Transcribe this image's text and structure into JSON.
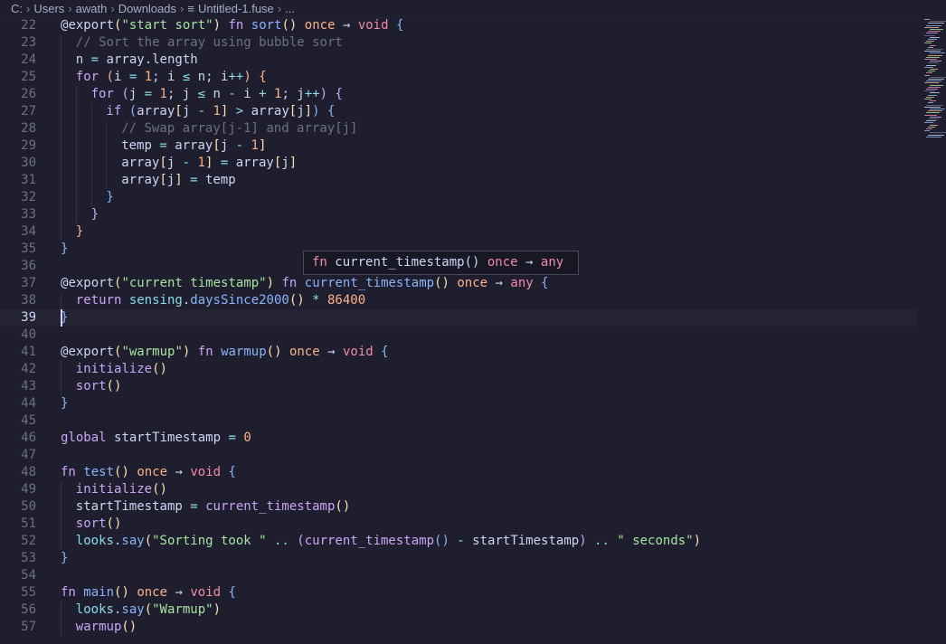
{
  "breadcrumb": {
    "items": [
      "C:",
      "Users",
      "awath",
      "Downloads"
    ],
    "file": "Untitled-1.fuse",
    "ellipsis": "..."
  },
  "colors": {
    "background": "#1e1e2e",
    "keyword": "#cba6f7",
    "function": "#89b4fa",
    "string": "#a6e3a1",
    "number": "#fab387",
    "comment": "#6c7086",
    "type": "#f38ba8",
    "text": "#cdd6f4"
  },
  "hover": {
    "signature": "fn current_timestamp() once → any"
  },
  "editor": {
    "active_line": 39,
    "lines": [
      {
        "n": 22,
        "indent": 0,
        "tokens": [
          [
            "@",
            "#cdd6f4"
          ],
          [
            "export",
            "#cdd6f4"
          ],
          [
            "(",
            "#f9e2af"
          ],
          [
            "\"start sort\"",
            "#a6e3a1"
          ],
          [
            ")",
            "#f9e2af"
          ],
          [
            " ",
            ""
          ],
          [
            "fn",
            "#cba6f7"
          ],
          [
            " ",
            ""
          ],
          [
            "sort",
            "#89b4fa"
          ],
          [
            "()",
            "#f9e2af"
          ],
          [
            " ",
            ""
          ],
          [
            "once",
            "#fab387"
          ],
          [
            " ",
            ""
          ],
          [
            "→",
            "#cdd6f4"
          ],
          [
            " ",
            ""
          ],
          [
            "void",
            "#f38ba8"
          ],
          [
            " ",
            ""
          ],
          [
            "{",
            "#89b4fa"
          ]
        ]
      },
      {
        "n": 23,
        "indent": 2,
        "tokens": [
          [
            "// Sort the array using bubble sort",
            "#6c7086"
          ]
        ]
      },
      {
        "n": 24,
        "indent": 2,
        "tokens": [
          [
            "n",
            "#cdd6f4"
          ],
          [
            " = ",
            "#89dceb"
          ],
          [
            "array",
            "#cdd6f4"
          ],
          [
            ".",
            "#cdd6f4"
          ],
          [
            "length",
            "#cdd6f4"
          ]
        ]
      },
      {
        "n": 25,
        "indent": 2,
        "tokens": [
          [
            "for",
            "#cba6f7"
          ],
          [
            " ",
            ""
          ],
          [
            "(",
            "#fab387"
          ],
          [
            "i",
            "#cdd6f4"
          ],
          [
            " = ",
            "#89dceb"
          ],
          [
            "1",
            "#fab387"
          ],
          [
            "; ",
            "#cdd6f4"
          ],
          [
            "i",
            "#cdd6f4"
          ],
          [
            " ≤ ",
            "#89dceb"
          ],
          [
            "n",
            "#cdd6f4"
          ],
          [
            "; ",
            "#cdd6f4"
          ],
          [
            "i",
            "#cdd6f4"
          ],
          [
            "++",
            "#89dceb"
          ],
          [
            ")",
            "#fab387"
          ],
          [
            " ",
            ""
          ],
          [
            "{",
            "#fab387"
          ]
        ]
      },
      {
        "n": 26,
        "indent": 4,
        "tokens": [
          [
            "for",
            "#cba6f7"
          ],
          [
            " ",
            ""
          ],
          [
            "(",
            "#cba6f7"
          ],
          [
            "j",
            "#cdd6f4"
          ],
          [
            " = ",
            "#89dceb"
          ],
          [
            "1",
            "#fab387"
          ],
          [
            "; ",
            "#cdd6f4"
          ],
          [
            "j",
            "#cdd6f4"
          ],
          [
            " ≤ ",
            "#89dceb"
          ],
          [
            "n",
            "#cdd6f4"
          ],
          [
            " - ",
            "#89dceb"
          ],
          [
            "i",
            "#cdd6f4"
          ],
          [
            " + ",
            "#89dceb"
          ],
          [
            "1",
            "#fab387"
          ],
          [
            "; ",
            "#cdd6f4"
          ],
          [
            "j",
            "#cdd6f4"
          ],
          [
            "++",
            "#89dceb"
          ],
          [
            ")",
            "#cba6f7"
          ],
          [
            " ",
            ""
          ],
          [
            "{",
            "#cba6f7"
          ]
        ]
      },
      {
        "n": 27,
        "indent": 6,
        "tokens": [
          [
            "if",
            "#cba6f7"
          ],
          [
            " ",
            ""
          ],
          [
            "(",
            "#89b4fa"
          ],
          [
            "array",
            "#cdd6f4"
          ],
          [
            "[",
            "#f9e2af"
          ],
          [
            "j",
            "#cdd6f4"
          ],
          [
            " - ",
            "#89dceb"
          ],
          [
            "1",
            "#fab387"
          ],
          [
            "]",
            "#f9e2af"
          ],
          [
            " > ",
            "#89dceb"
          ],
          [
            "array",
            "#cdd6f4"
          ],
          [
            "[",
            "#f9e2af"
          ],
          [
            "j",
            "#cdd6f4"
          ],
          [
            "]",
            "#f9e2af"
          ],
          [
            ")",
            "#89b4fa"
          ],
          [
            " ",
            ""
          ],
          [
            "{",
            "#89b4fa"
          ]
        ]
      },
      {
        "n": 28,
        "indent": 8,
        "tokens": [
          [
            "// Swap array[j-1] and array[j]",
            "#6c7086"
          ]
        ]
      },
      {
        "n": 29,
        "indent": 8,
        "tokens": [
          [
            "temp",
            "#cdd6f4"
          ],
          [
            " = ",
            "#89dceb"
          ],
          [
            "array",
            "#cdd6f4"
          ],
          [
            "[",
            "#f9e2af"
          ],
          [
            "j",
            "#cdd6f4"
          ],
          [
            " - ",
            "#89dceb"
          ],
          [
            "1",
            "#fab387"
          ],
          [
            "]",
            "#f9e2af"
          ]
        ]
      },
      {
        "n": 30,
        "indent": 8,
        "tokens": [
          [
            "array",
            "#cdd6f4"
          ],
          [
            "[",
            "#f9e2af"
          ],
          [
            "j",
            "#cdd6f4"
          ],
          [
            " - ",
            "#89dceb"
          ],
          [
            "1",
            "#fab387"
          ],
          [
            "]",
            "#f9e2af"
          ],
          [
            " = ",
            "#89dceb"
          ],
          [
            "array",
            "#cdd6f4"
          ],
          [
            "[",
            "#f9e2af"
          ],
          [
            "j",
            "#cdd6f4"
          ],
          [
            "]",
            "#f9e2af"
          ]
        ]
      },
      {
        "n": 31,
        "indent": 8,
        "tokens": [
          [
            "array",
            "#cdd6f4"
          ],
          [
            "[",
            "#f9e2af"
          ],
          [
            "j",
            "#cdd6f4"
          ],
          [
            "]",
            "#f9e2af"
          ],
          [
            " = ",
            "#89dceb"
          ],
          [
            "temp",
            "#cdd6f4"
          ]
        ]
      },
      {
        "n": 32,
        "indent": 6,
        "tokens": [
          [
            "}",
            "#89b4fa"
          ]
        ]
      },
      {
        "n": 33,
        "indent": 4,
        "tokens": [
          [
            "}",
            "#cba6f7"
          ]
        ]
      },
      {
        "n": 34,
        "indent": 2,
        "tokens": [
          [
            "}",
            "#fab387"
          ]
        ]
      },
      {
        "n": 35,
        "indent": 0,
        "tokens": [
          [
            "}",
            "#89b4fa"
          ]
        ]
      },
      {
        "n": 36,
        "indent": 0,
        "tokens": []
      },
      {
        "n": 37,
        "indent": 0,
        "tokens": [
          [
            "@",
            "#cdd6f4"
          ],
          [
            "export",
            "#cdd6f4"
          ],
          [
            "(",
            "#f9e2af"
          ],
          [
            "\"current timestamp\"",
            "#a6e3a1"
          ],
          [
            ")",
            "#f9e2af"
          ],
          [
            " ",
            ""
          ],
          [
            "fn",
            "#cba6f7"
          ],
          [
            " ",
            ""
          ],
          [
            "current_timestamp",
            "#89b4fa"
          ],
          [
            "()",
            "#f9e2af"
          ],
          [
            " ",
            ""
          ],
          [
            "once",
            "#fab387"
          ],
          [
            " ",
            ""
          ],
          [
            "→",
            "#cdd6f4"
          ],
          [
            " ",
            ""
          ],
          [
            "any",
            "#f38ba8"
          ],
          [
            " ",
            ""
          ],
          [
            "{",
            "#89b4fa"
          ]
        ]
      },
      {
        "n": 38,
        "indent": 2,
        "tokens": [
          [
            "return",
            "#cba6f7"
          ],
          [
            " ",
            ""
          ],
          [
            "sensing",
            "#89dceb"
          ],
          [
            ".",
            "#cdd6f4"
          ],
          [
            "daysSince2000",
            "#89b4fa"
          ],
          [
            "()",
            "#f9e2af"
          ],
          [
            " * ",
            "#89dceb"
          ],
          [
            "86400",
            "#fab387"
          ]
        ]
      },
      {
        "n": 39,
        "indent": 0,
        "tokens": [
          [
            "}",
            "#89b4fa"
          ]
        ]
      },
      {
        "n": 40,
        "indent": 0,
        "tokens": []
      },
      {
        "n": 41,
        "indent": 0,
        "tokens": [
          [
            "@",
            "#cdd6f4"
          ],
          [
            "export",
            "#cdd6f4"
          ],
          [
            "(",
            "#f9e2af"
          ],
          [
            "\"warmup\"",
            "#a6e3a1"
          ],
          [
            ")",
            "#f9e2af"
          ],
          [
            " ",
            ""
          ],
          [
            "fn",
            "#cba6f7"
          ],
          [
            " ",
            ""
          ],
          [
            "warmup",
            "#89b4fa"
          ],
          [
            "()",
            "#f9e2af"
          ],
          [
            " ",
            ""
          ],
          [
            "once",
            "#fab387"
          ],
          [
            " ",
            ""
          ],
          [
            "→",
            "#cdd6f4"
          ],
          [
            " ",
            ""
          ],
          [
            "void",
            "#f38ba8"
          ],
          [
            " ",
            ""
          ],
          [
            "{",
            "#89b4fa"
          ]
        ]
      },
      {
        "n": 42,
        "indent": 2,
        "tokens": [
          [
            "initialize",
            "#cba6f7"
          ],
          [
            "()",
            "#f9e2af"
          ]
        ]
      },
      {
        "n": 43,
        "indent": 2,
        "tokens": [
          [
            "sort",
            "#cba6f7"
          ],
          [
            "()",
            "#f9e2af"
          ]
        ]
      },
      {
        "n": 44,
        "indent": 0,
        "tokens": [
          [
            "}",
            "#89b4fa"
          ]
        ]
      },
      {
        "n": 45,
        "indent": 0,
        "tokens": []
      },
      {
        "n": 46,
        "indent": 0,
        "tokens": [
          [
            "global",
            "#cba6f7"
          ],
          [
            " ",
            ""
          ],
          [
            "startTimestamp",
            "#cdd6f4"
          ],
          [
            " = ",
            "#89dceb"
          ],
          [
            "0",
            "#fab387"
          ]
        ]
      },
      {
        "n": 47,
        "indent": 0,
        "tokens": []
      },
      {
        "n": 48,
        "indent": 0,
        "tokens": [
          [
            "fn",
            "#cba6f7"
          ],
          [
            " ",
            ""
          ],
          [
            "test",
            "#89b4fa"
          ],
          [
            "()",
            "#f9e2af"
          ],
          [
            " ",
            ""
          ],
          [
            "once",
            "#fab387"
          ],
          [
            " ",
            ""
          ],
          [
            "→",
            "#cdd6f4"
          ],
          [
            " ",
            ""
          ],
          [
            "void",
            "#f38ba8"
          ],
          [
            " ",
            ""
          ],
          [
            "{",
            "#89b4fa"
          ]
        ]
      },
      {
        "n": 49,
        "indent": 2,
        "tokens": [
          [
            "initialize",
            "#cba6f7"
          ],
          [
            "()",
            "#f9e2af"
          ]
        ]
      },
      {
        "n": 50,
        "indent": 2,
        "tokens": [
          [
            "startTimestamp",
            "#cdd6f4"
          ],
          [
            " = ",
            "#89dceb"
          ],
          [
            "current_timestamp",
            "#cba6f7"
          ],
          [
            "()",
            "#f9e2af"
          ]
        ]
      },
      {
        "n": 51,
        "indent": 2,
        "tokens": [
          [
            "sort",
            "#cba6f7"
          ],
          [
            "()",
            "#f9e2af"
          ]
        ]
      },
      {
        "n": 52,
        "indent": 2,
        "tokens": [
          [
            "looks",
            "#89dceb"
          ],
          [
            ".",
            "#cdd6f4"
          ],
          [
            "say",
            "#89b4fa"
          ],
          [
            "(",
            "#f9e2af"
          ],
          [
            "\"Sorting took \"",
            "#a6e3a1"
          ],
          [
            " .. ",
            "#89dceb"
          ],
          [
            "(",
            "#cba6f7"
          ],
          [
            "current_timestamp",
            "#cba6f7"
          ],
          [
            "()",
            "#89b4fa"
          ],
          [
            " - ",
            "#89dceb"
          ],
          [
            "startTimestamp",
            "#cdd6f4"
          ],
          [
            ")",
            "#cba6f7"
          ],
          [
            " .. ",
            "#89dceb"
          ],
          [
            "\" seconds\"",
            "#a6e3a1"
          ],
          [
            ")",
            "#f9e2af"
          ]
        ]
      },
      {
        "n": 53,
        "indent": 0,
        "tokens": [
          [
            "}",
            "#89b4fa"
          ]
        ]
      },
      {
        "n": 54,
        "indent": 0,
        "tokens": []
      },
      {
        "n": 55,
        "indent": 0,
        "tokens": [
          [
            "fn",
            "#cba6f7"
          ],
          [
            " ",
            ""
          ],
          [
            "main",
            "#89b4fa"
          ],
          [
            "()",
            "#f9e2af"
          ],
          [
            " ",
            ""
          ],
          [
            "once",
            "#fab387"
          ],
          [
            " ",
            ""
          ],
          [
            "→",
            "#cdd6f4"
          ],
          [
            " ",
            ""
          ],
          [
            "void",
            "#f38ba8"
          ],
          [
            " ",
            ""
          ],
          [
            "{",
            "#89b4fa"
          ]
        ]
      },
      {
        "n": 56,
        "indent": 2,
        "tokens": [
          [
            "looks",
            "#89dceb"
          ],
          [
            ".",
            "#cdd6f4"
          ],
          [
            "say",
            "#89b4fa"
          ],
          [
            "(",
            "#f9e2af"
          ],
          [
            "\"Warmup\"",
            "#a6e3a1"
          ],
          [
            ")",
            "#f9e2af"
          ]
        ]
      },
      {
        "n": 57,
        "indent": 2,
        "tokens": [
          [
            "warmup",
            "#cba6f7"
          ],
          [
            "()",
            "#f9e2af"
          ]
        ]
      }
    ]
  }
}
